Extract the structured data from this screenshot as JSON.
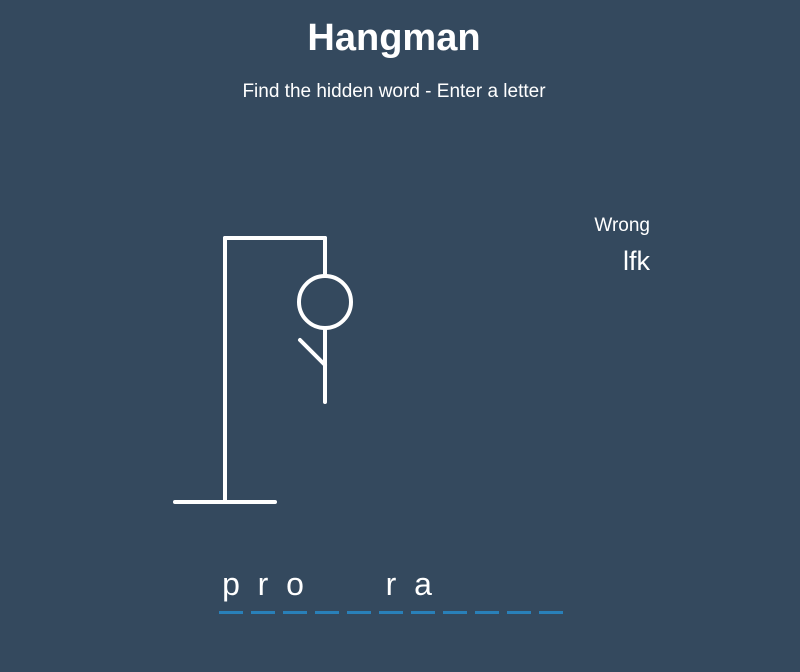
{
  "header": {
    "title": "Hangman",
    "subtitle": "Find the hidden word - Enter a letter"
  },
  "wrong": {
    "label": "Wrong",
    "letters": "lfk"
  },
  "word": {
    "slots": [
      "p",
      "r",
      "o",
      "",
      "",
      "r",
      "a",
      "",
      "",
      "",
      ""
    ]
  },
  "figure": {
    "parts_shown": [
      "gallows",
      "head",
      "body",
      "left-arm"
    ],
    "color": "#ffffff"
  },
  "colors": {
    "background": "#34495e",
    "underline": "#2980b9",
    "text": "#ffffff"
  }
}
